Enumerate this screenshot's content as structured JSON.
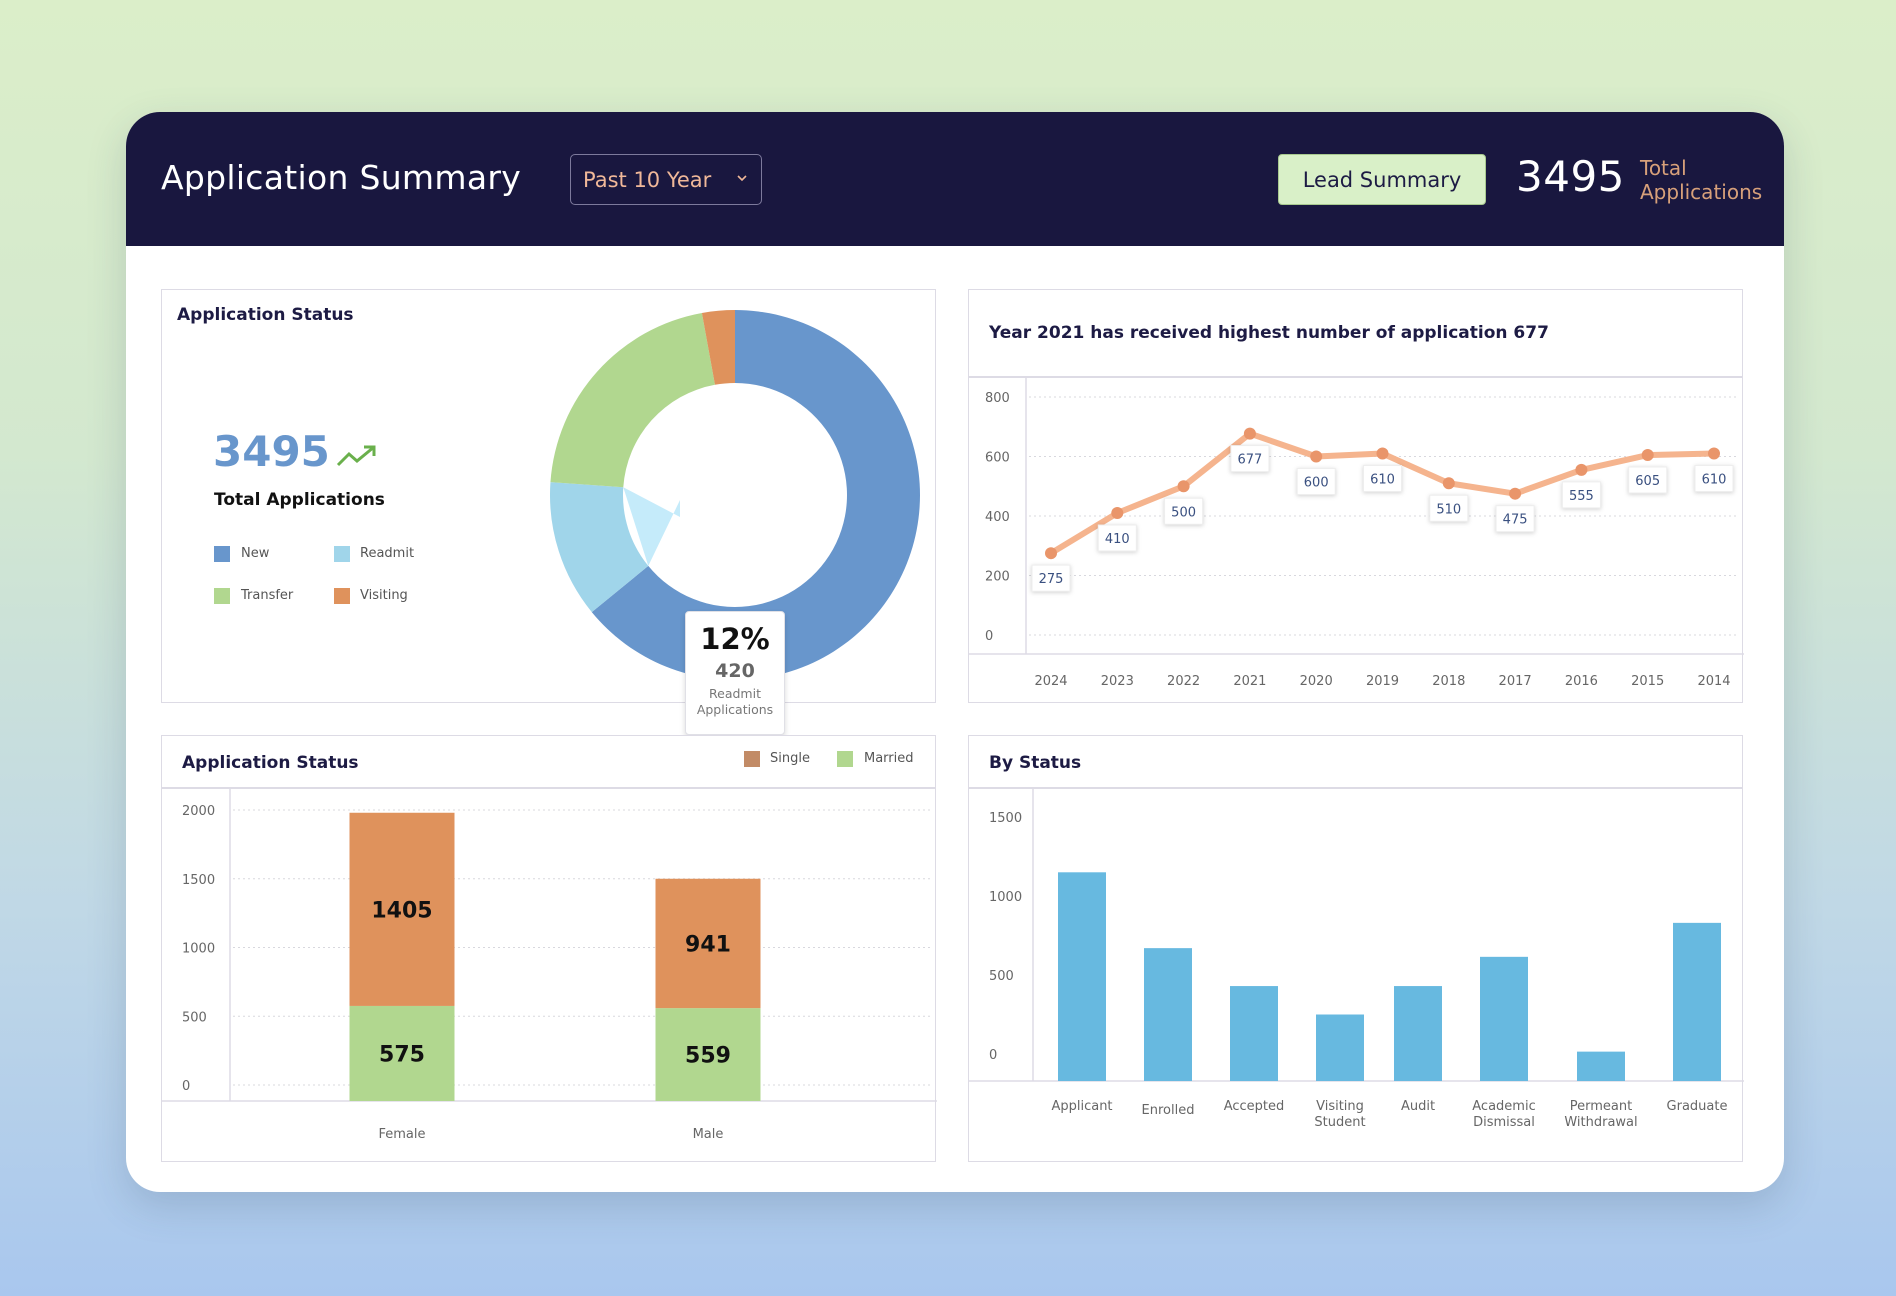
{
  "header": {
    "title": "Application Summary",
    "range_select": "Past 10 Year",
    "lead_summary_button": "Lead Summary",
    "total_value": "3495",
    "total_label": "Total Applications"
  },
  "status_card": {
    "title": "Application Status",
    "total_value": "3495",
    "total_label": "Total Applications",
    "trend_icon": "trending-up-icon",
    "legend": [
      {
        "label": "New",
        "color": "#6896cc"
      },
      {
        "label": "Readmit",
        "color": "#a0d5ea"
      },
      {
        "label": "Transfer",
        "color": "#b1d78f"
      },
      {
        "label": "Visiting",
        "color": "#df925c"
      }
    ],
    "tooltip": {
      "percent": "12%",
      "count": "420",
      "label_line1": "Readmit",
      "label_line2": "Applications"
    }
  },
  "line_card": {
    "title": "Year 2021 has received highest number of application 677"
  },
  "gender_card": {
    "title": "Application Status",
    "legend": [
      {
        "label": "Single",
        "color": "#c28b66"
      },
      {
        "label": "Married",
        "color": "#b1d78f"
      }
    ]
  },
  "by_status_card": {
    "title": "By Status"
  },
  "chart_data": [
    {
      "type": "pie",
      "title": "Application Status",
      "donut": true,
      "categories": [
        "New",
        "Readmit",
        "Transfer",
        "Visiting"
      ],
      "values": [
        2240,
        420,
        735,
        100
      ],
      "colors": [
        "#6896cc",
        "#a0d5ea",
        "#b1d78f",
        "#df925c"
      ],
      "highlighted": "Readmit",
      "annotation": "12% 420 Readmit Applications"
    },
    {
      "type": "line",
      "title": "Year 2021 has received highest number of application 677",
      "categories": [
        "2024",
        "2023",
        "2022",
        "2021",
        "2020",
        "2019",
        "2018",
        "2017",
        "2016",
        "2015",
        "2014"
      ],
      "values": [
        275,
        410,
        500,
        677,
        600,
        610,
        510,
        475,
        555,
        605,
        610
      ],
      "xlabel": "",
      "ylabel": "",
      "ylim": [
        0,
        800
      ],
      "yticks": [
        0,
        200,
        400,
        600,
        800
      ],
      "grid": true,
      "data_labels": true,
      "color": "#f5b48e"
    },
    {
      "type": "bar",
      "stacked": true,
      "title": "Application Status",
      "categories": [
        "Female",
        "Male"
      ],
      "series": [
        {
          "name": "Married",
          "values": [
            575,
            559
          ],
          "color": "#b1d78f"
        },
        {
          "name": "Single",
          "values": [
            1405,
            941
          ],
          "color": "#df925c"
        }
      ],
      "ylim": [
        0,
        2000
      ],
      "yticks": [
        0,
        500,
        1000,
        1500,
        2000
      ],
      "grid": true,
      "legend": "top-right",
      "data_labels": true
    },
    {
      "type": "bar",
      "title": "By Status",
      "categories": [
        "Applicant",
        "Enrolled",
        "Accepted",
        "Visiting Student",
        "Audit",
        "Academic Dismissal",
        "Permeant Withdrawal",
        "Graduate"
      ],
      "values": [
        1150,
        670,
        430,
        250,
        430,
        615,
        15,
        830
      ],
      "ylim": [
        -170,
        1600
      ],
      "yticks": [
        0,
        500,
        1000,
        1500
      ],
      "grid": false,
      "color": "#67b9e0",
      "note": "Values are approximate: read against the labeled 0 line, but the bars extend below it to a baseline near -170"
    }
  ]
}
